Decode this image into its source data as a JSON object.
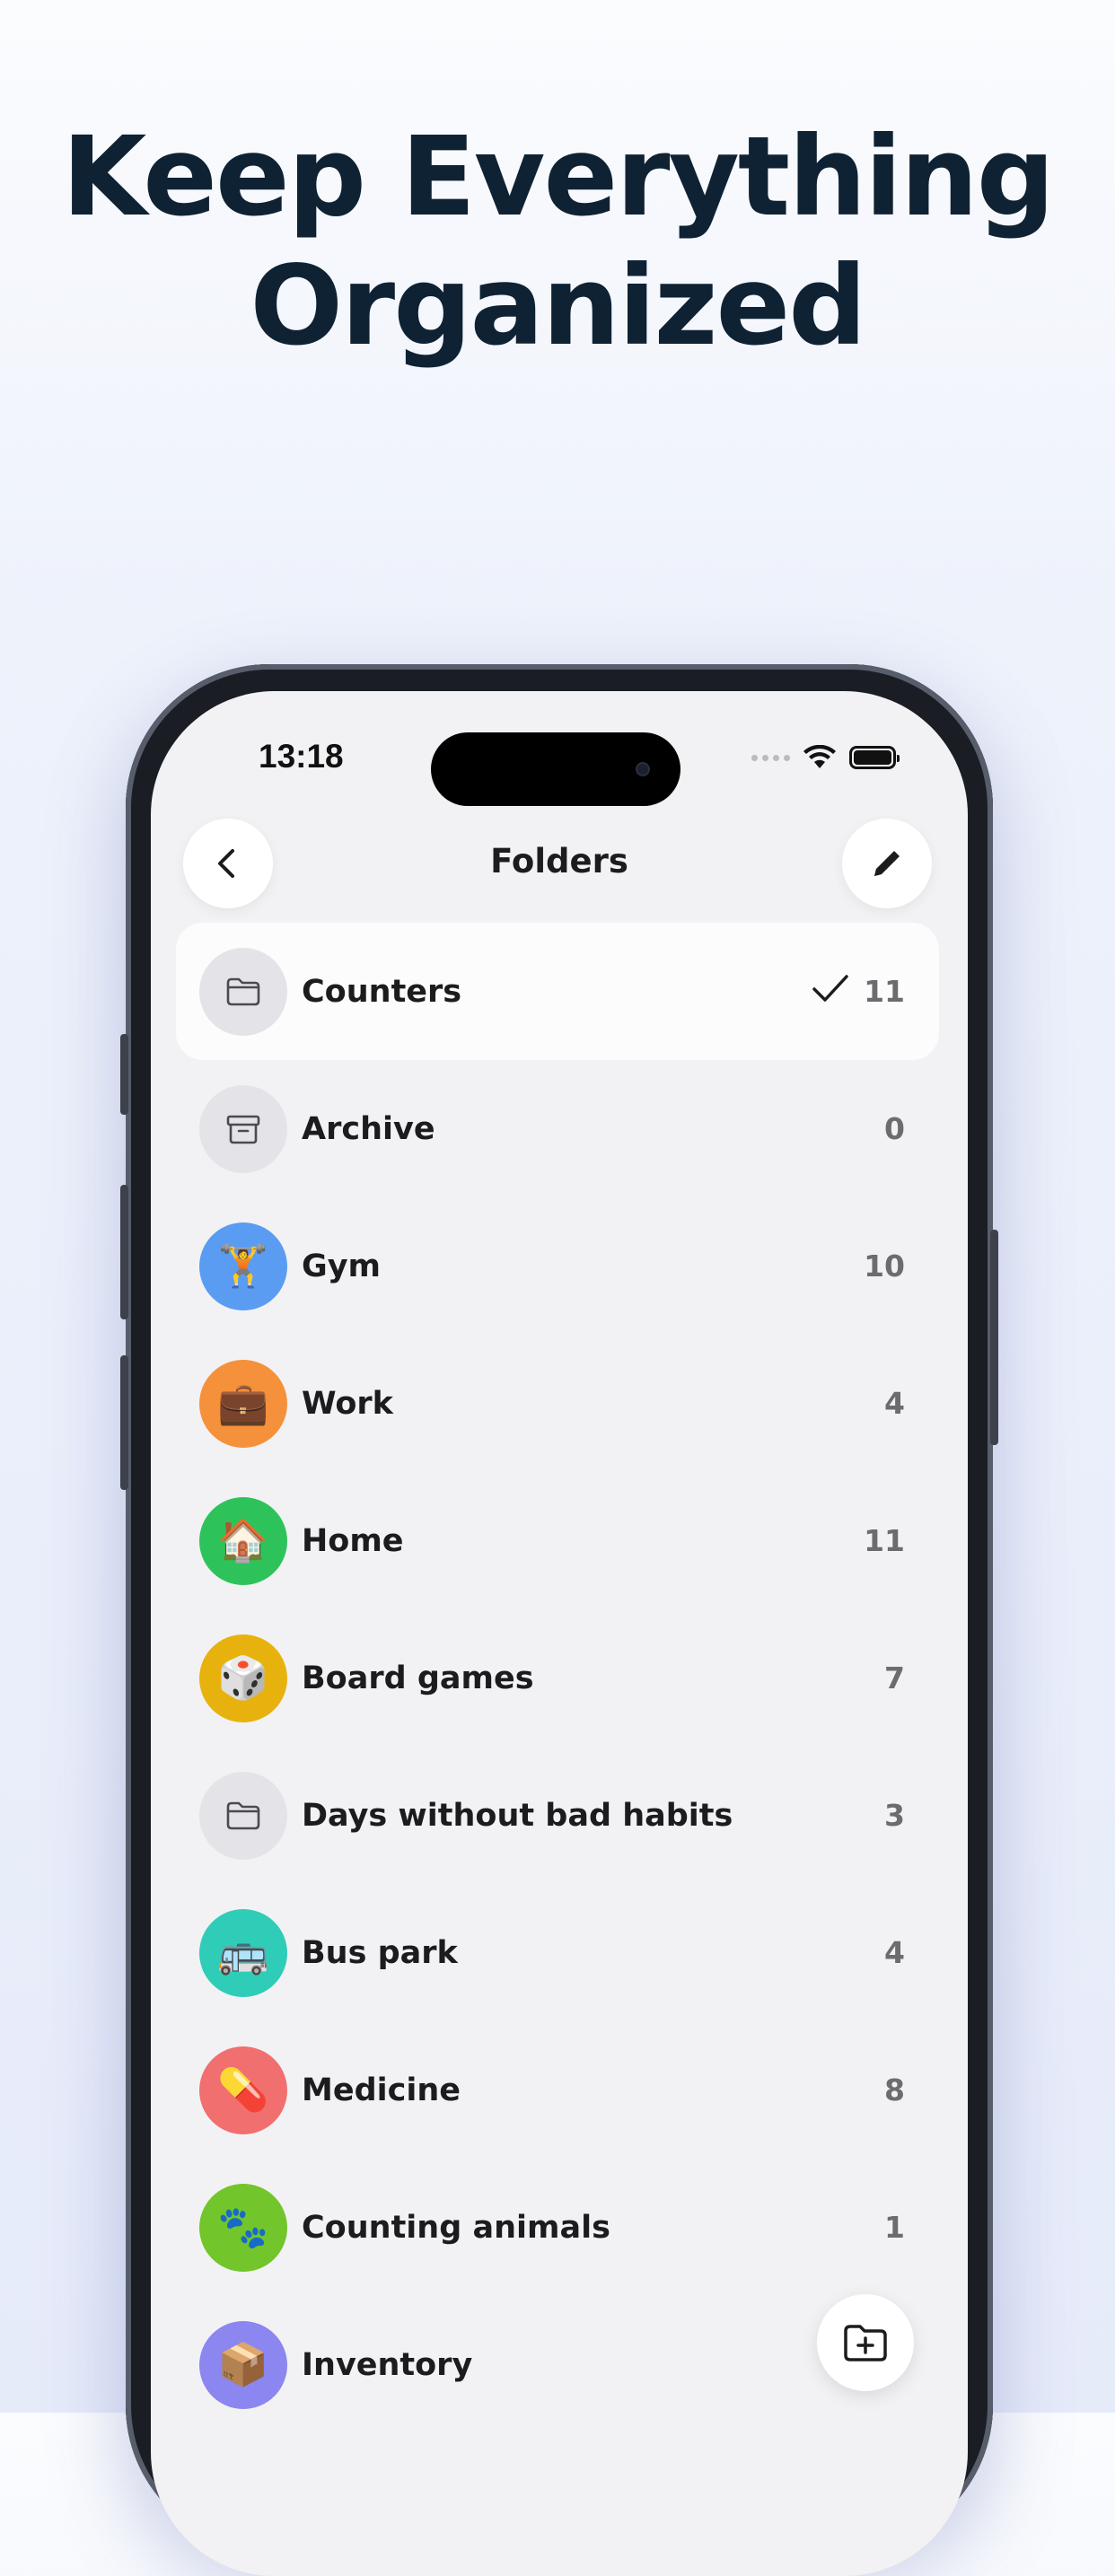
{
  "headline": {
    "line1": "Keep Everything",
    "line2": "Organized"
  },
  "status_bar": {
    "time": "13:18"
  },
  "nav": {
    "title": "Folders"
  },
  "folders": [
    {
      "label": "Counters",
      "count": "11",
      "icon": "folder-icon",
      "color": "#e4e4e8",
      "selected": true
    },
    {
      "label": "Archive",
      "count": "0",
      "icon": "archive-icon",
      "color": "#e4e4e8"
    },
    {
      "label": "Gym",
      "count": "10",
      "icon": "🏋️",
      "color": "#5a9cf2"
    },
    {
      "label": "Work",
      "count": "4",
      "icon": "💼",
      "color": "#f5913a"
    },
    {
      "label": "Home",
      "count": "11",
      "icon": "🏠",
      "color": "#2ec35a"
    },
    {
      "label": "Board games",
      "count": "7",
      "icon": "🎲",
      "color": "#e8b20e"
    },
    {
      "label": "Days without bad habits",
      "count": "3",
      "icon": "folder-icon",
      "color": "#e4e4e8"
    },
    {
      "label": "Bus park",
      "count": "4",
      "icon": "🚌",
      "color": "#2fcdb8"
    },
    {
      "label": "Medicine",
      "count": "8",
      "icon": "💊",
      "color": "#f26f6f"
    },
    {
      "label": "Counting animals",
      "count": "1",
      "icon": "🐾",
      "color": "#72c52a"
    },
    {
      "label": "Inventory",
      "count": "",
      "icon": "📦",
      "color": "#8b86f0"
    }
  ]
}
